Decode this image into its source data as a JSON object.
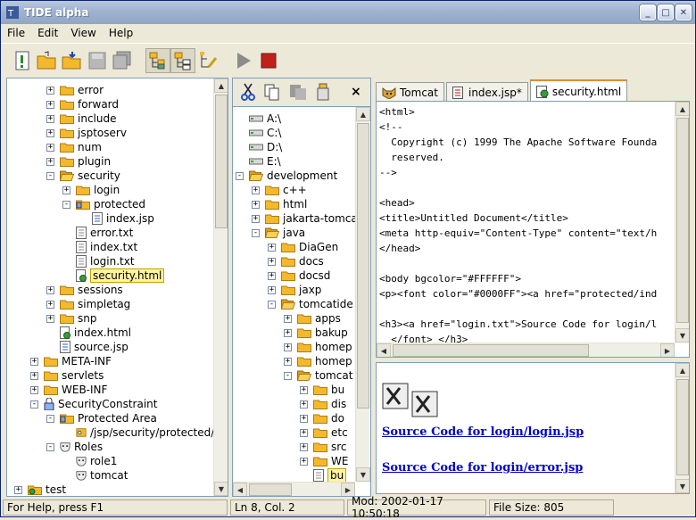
{
  "window": {
    "title": "TIDE alpha"
  },
  "menu": [
    "File",
    "Edit",
    "View",
    "Help"
  ],
  "toolbar_icons": [
    "new-icon",
    "open-folder-icon",
    "open-recent-icon",
    "save-icon",
    "save-all-icon",
    "project-view-icon",
    "tree-view-icon",
    "edit-config-icon",
    "run-icon",
    "stop-icon"
  ],
  "project_tree": [
    {
      "label": "error",
      "type": "folder",
      "depth": 2,
      "exp": "+"
    },
    {
      "label": "forward",
      "type": "folder",
      "depth": 2,
      "exp": "+"
    },
    {
      "label": "include",
      "type": "folder",
      "depth": 2,
      "exp": "+"
    },
    {
      "label": "jsptoserv",
      "type": "folder",
      "depth": 2,
      "exp": "+"
    },
    {
      "label": "num",
      "type": "folder",
      "depth": 2,
      "exp": "+"
    },
    {
      "label": "plugin",
      "type": "folder",
      "depth": 2,
      "exp": "+"
    },
    {
      "label": "security",
      "type": "openfolder",
      "depth": 2,
      "exp": "-"
    },
    {
      "label": "login",
      "type": "folder",
      "depth": 3,
      "exp": "+"
    },
    {
      "label": "protected",
      "type": "lockfolder",
      "depth": 3,
      "exp": "-"
    },
    {
      "label": "index.jsp",
      "type": "jsp",
      "depth": 4,
      "exp": ""
    },
    {
      "label": "error.txt",
      "type": "txt",
      "depth": 3,
      "exp": ""
    },
    {
      "label": "index.txt",
      "type": "txt",
      "depth": 3,
      "exp": ""
    },
    {
      "label": "login.txt",
      "type": "txt",
      "depth": 3,
      "exp": ""
    },
    {
      "label": "security.html",
      "type": "html",
      "depth": 3,
      "exp": "",
      "selected": true
    },
    {
      "label": "sessions",
      "type": "folder",
      "depth": 2,
      "exp": "+"
    },
    {
      "label": "simpletag",
      "type": "folder",
      "depth": 2,
      "exp": "+"
    },
    {
      "label": "snp",
      "type": "folder",
      "depth": 2,
      "exp": "+"
    },
    {
      "label": "index.html",
      "type": "html",
      "depth": 2,
      "exp": ""
    },
    {
      "label": "source.jsp",
      "type": "jsp",
      "depth": 2,
      "exp": ""
    },
    {
      "label": "META-INF",
      "type": "folder",
      "depth": 1,
      "exp": "+"
    },
    {
      "label": "servlets",
      "type": "folder",
      "depth": 1,
      "exp": "+"
    },
    {
      "label": "WEB-INF",
      "type": "folder",
      "depth": 1,
      "exp": "+"
    },
    {
      "label": "SecurityConstraint",
      "type": "lock",
      "depth": 1,
      "exp": "-"
    },
    {
      "label": "Protected Area",
      "type": "lockfolder",
      "depth": 2,
      "exp": "-"
    },
    {
      "label": "/jsp/security/protected/*",
      "type": "key",
      "depth": 3,
      "exp": ""
    },
    {
      "label": "Roles",
      "type": "mask",
      "depth": 2,
      "exp": "-"
    },
    {
      "label": "role1",
      "type": "mask",
      "depth": 3,
      "exp": ""
    },
    {
      "label": "tomcat",
      "type": "mask",
      "depth": 3,
      "exp": ""
    },
    {
      "label": "test",
      "type": "globefolder",
      "depth": 0,
      "exp": "+"
    }
  ],
  "file_tree": [
    {
      "label": "A:\\",
      "type": "drive",
      "depth": 0,
      "exp": ""
    },
    {
      "label": "C:\\",
      "type": "drive",
      "depth": 0,
      "exp": ""
    },
    {
      "label": "D:\\",
      "type": "drive",
      "depth": 0,
      "exp": ""
    },
    {
      "label": "E:\\",
      "type": "drive",
      "depth": 0,
      "exp": ""
    },
    {
      "label": "development",
      "type": "openfolder",
      "depth": 0,
      "exp": "-"
    },
    {
      "label": "c++",
      "type": "folder",
      "depth": 1,
      "exp": "+"
    },
    {
      "label": "html",
      "type": "folder",
      "depth": 1,
      "exp": "+"
    },
    {
      "label": "jakarta-tomcat",
      "type": "folder",
      "depth": 1,
      "exp": "+"
    },
    {
      "label": "java",
      "type": "openfolder",
      "depth": 1,
      "exp": "-"
    },
    {
      "label": "DiaGen",
      "type": "folder",
      "depth": 2,
      "exp": "+"
    },
    {
      "label": "docs",
      "type": "folder",
      "depth": 2,
      "exp": "+"
    },
    {
      "label": "docsd",
      "type": "folder",
      "depth": 2,
      "exp": "+"
    },
    {
      "label": "jaxp",
      "type": "folder",
      "depth": 2,
      "exp": "+"
    },
    {
      "label": "tomcatide",
      "type": "openfolder",
      "depth": 2,
      "exp": "-"
    },
    {
      "label": "apps",
      "type": "folder",
      "depth": 3,
      "exp": "+"
    },
    {
      "label": "bakup",
      "type": "folder",
      "depth": 3,
      "exp": "+"
    },
    {
      "label": "homep",
      "type": "folder",
      "depth": 3,
      "exp": "+"
    },
    {
      "label": "homep",
      "type": "folder",
      "depth": 3,
      "exp": "+"
    },
    {
      "label": "tomcat",
      "type": "openfolder",
      "depth": 3,
      "exp": "-"
    },
    {
      "label": "bu",
      "type": "folder",
      "depth": 4,
      "exp": "+"
    },
    {
      "label": "dis",
      "type": "folder",
      "depth": 4,
      "exp": "+"
    },
    {
      "label": "do",
      "type": "folder",
      "depth": 4,
      "exp": "+"
    },
    {
      "label": "etc",
      "type": "folder",
      "depth": 4,
      "exp": "+"
    },
    {
      "label": "src",
      "type": "folder",
      "depth": 4,
      "exp": "+"
    },
    {
      "label": "WE",
      "type": "folder",
      "depth": 4,
      "exp": "+"
    },
    {
      "label": "bu",
      "type": "txt",
      "depth": 4,
      "exp": "",
      "selected": true
    }
  ],
  "file_toolbar": {
    "close": "×"
  },
  "tabs": [
    {
      "label": "Tomcat",
      "icon": "tomcat-icon"
    },
    {
      "label": "index.jsp*",
      "icon": "jsp-file-icon"
    },
    {
      "label": "security.html",
      "icon": "html-file-icon"
    }
  ],
  "editor_lines": [
    "<html>",
    "<!--",
    "  Copyright (c) 1999 The Apache Software Founda",
    "  reserved.",
    "-->",
    "",
    "<head>",
    "<title>Untitled Document</title>",
    "<meta http-equiv=\"Content-Type\" content=\"text/h",
    "</head>",
    "",
    "<body bgcolor=\"#FFFFFF\">",
    "<p><font color=\"#0000FF\"><a href=\"protected/ind",
    "",
    "<h3><a href=\"login.txt\">Source Code for login/l",
    "  </font> </h3>"
  ],
  "preview": {
    "link1": "Source Code for login/login.jsp",
    "link2": "Source Code for login/error.jsp"
  },
  "status": {
    "help": "For Help, press F1",
    "position": "Ln 8, Col. 2",
    "modified": "Mod: 2002-01-17 10:50:18",
    "size": "File Size: 805"
  }
}
